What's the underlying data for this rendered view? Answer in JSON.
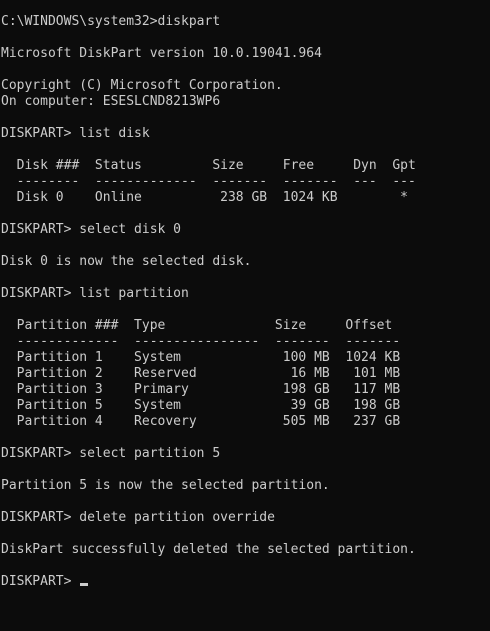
{
  "console": {
    "lines": [
      "C:\\WINDOWS\\system32>diskpart",
      "",
      "Microsoft DiskPart version 10.0.19041.964",
      "",
      "Copyright (C) Microsoft Corporation.",
      "On computer: ESESLCND8213WP6",
      "",
      "DISKPART> list disk",
      "",
      "  Disk ###  Status         Size     Free     Dyn  Gpt",
      "  --------  -------------  -------  -------  ---  ---",
      "  Disk 0    Online          238 GB  1024 KB        *",
      "",
      "DISKPART> select disk 0",
      "",
      "Disk 0 is now the selected disk.",
      "",
      "DISKPART> list partition",
      "",
      "  Partition ###  Type              Size     Offset",
      "  -------------  ----------------  -------  -------",
      "  Partition 1    System             100 MB  1024 KB",
      "  Partition 2    Reserved            16 MB   101 MB",
      "  Partition 3    Primary            198 GB   117 MB",
      "  Partition 5    System              39 GB   198 GB",
      "  Partition 4    Recovery           505 MB   237 GB",
      "",
      "DISKPART> select partition 5",
      "",
      "Partition 5 is now the selected partition.",
      "",
      "DISKPART> delete partition override",
      "",
      "DiskPart successfully deleted the selected partition.",
      "",
      "DISKPART> "
    ]
  },
  "colors": {
    "background": "#0c0c0c",
    "text": "#cccccc"
  }
}
